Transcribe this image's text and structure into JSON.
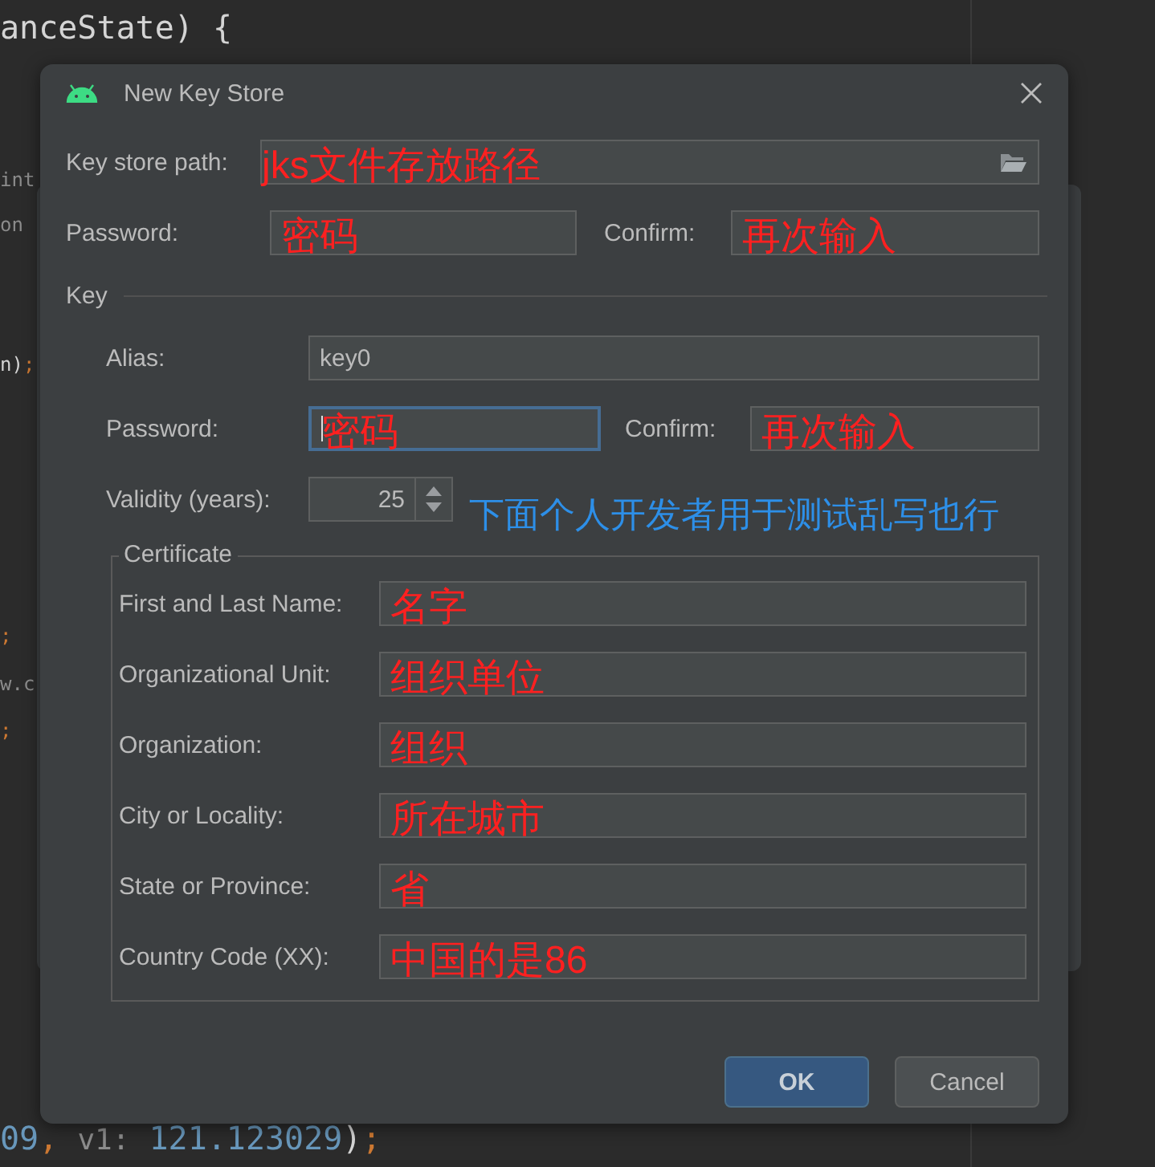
{
  "editor": {
    "lines": [
      {
        "segments": [
          {
            "text": "anceState) {",
            "kind": "plain"
          }
        ]
      },
      {
        "segments": [
          {
            "text": "int",
            "kind": "hint"
          }
        ]
      },
      {
        "segments": [
          {
            "text": "on",
            "kind": "hint"
          }
        ]
      },
      {
        "segments": [
          {
            "text": "n)",
            "kind": "plain"
          },
          {
            "text": ";",
            "kind": "punct"
          }
        ]
      },
      {
        "segments": [
          {
            "text": ";",
            "kind": "punct"
          }
        ]
      },
      {
        "segments": [
          {
            "text": "w.c",
            "kind": "hint"
          }
        ]
      },
      {
        "segments": [
          {
            "text": ";",
            "kind": "punct"
          }
        ]
      },
      {
        "segments": [
          {
            "text": "09",
            "kind": "number"
          },
          {
            "text": ", ",
            "kind": "punct"
          },
          {
            "text": "v1:",
            "kind": "hint"
          },
          {
            "text": " 121.123029",
            "kind": "number"
          },
          {
            "text": ")",
            "kind": "plain"
          },
          {
            "text": ";",
            "kind": "punct"
          }
        ]
      }
    ]
  },
  "dialog": {
    "title": "New Key Store",
    "key_store_path": {
      "label": "Key store path:",
      "annotation": "jks文件存放路径"
    },
    "password": {
      "label": "Password:",
      "annotation": "密码"
    },
    "confirm": {
      "label": "Confirm:",
      "annotation": "再次输入"
    },
    "key": {
      "heading": "Key",
      "alias": {
        "label": "Alias:",
        "value": "key0"
      },
      "password": {
        "label": "Password:",
        "annotation": "密码",
        "focused": true
      },
      "confirm": {
        "label": "Confirm:",
        "annotation": "再次输入"
      },
      "validity": {
        "label": "Validity (years):",
        "value": "25"
      },
      "note": "下面个人开发者用于测试乱写也行",
      "certificate": {
        "heading": "Certificate",
        "fields": [
          {
            "label": "First and Last Name:",
            "annotation": "名字"
          },
          {
            "label": "Organizational Unit:",
            "annotation": "组织单位"
          },
          {
            "label": "Organization:",
            "annotation": "组织"
          },
          {
            "label": "City or Locality:",
            "annotation": "所在城市"
          },
          {
            "label": "State or Province:",
            "annotation": "省"
          },
          {
            "label": "Country Code (XX):",
            "annotation": "中国的是86"
          }
        ]
      }
    },
    "buttons": [
      {
        "label": "OK",
        "default": true
      },
      {
        "label": "Cancel",
        "default": false
      }
    ]
  }
}
